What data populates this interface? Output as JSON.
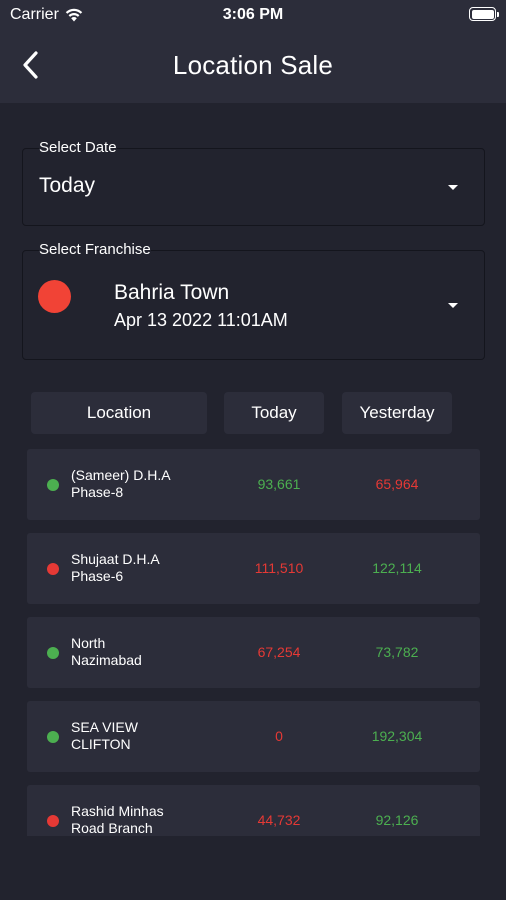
{
  "status_bar": {
    "carrier": "Carrier",
    "time": "3:06 PM"
  },
  "nav": {
    "title": "Location Sale",
    "back_icon": "chevron-left-icon"
  },
  "date_select": {
    "label": "Select Date",
    "value": "Today"
  },
  "franchise_select": {
    "label": "Select Franchise",
    "name": "Bahria Town",
    "datetime": "Apr 13 2022 11:01AM",
    "status_color": "#f14336"
  },
  "table": {
    "headers": {
      "location": "Location",
      "today": "Today",
      "yesterday": "Yesterday"
    },
    "rows": [
      {
        "name": "(Sameer)  D.H.A\nPhase-8",
        "status": "green",
        "today": "93,661",
        "today_color": "green",
        "yesterday": "65,964",
        "yesterday_color": "red"
      },
      {
        "name": "Shujaat D.H.A\nPhase-6",
        "status": "red",
        "today": "111,510",
        "today_color": "red",
        "yesterday": "122,114",
        "yesterday_color": "green"
      },
      {
        "name": "North\nNazimabad",
        "status": "green",
        "today": "67,254",
        "today_color": "red",
        "yesterday": "73,782",
        "yesterday_color": "green"
      },
      {
        "name": "SEA VIEW\nCLIFTON",
        "status": "green",
        "today": "0",
        "today_color": "red",
        "yesterday": "192,304",
        "yesterday_color": "green"
      },
      {
        "name": "Rashid Minhas\nRoad Branch",
        "status": "red",
        "today": "44,732",
        "today_color": "red",
        "yesterday": "92,126",
        "yesterday_color": "green"
      }
    ]
  },
  "colors": {
    "background": "#22232e",
    "surface": "#2c2d3a",
    "green": "#4caf50",
    "red": "#e53935"
  }
}
